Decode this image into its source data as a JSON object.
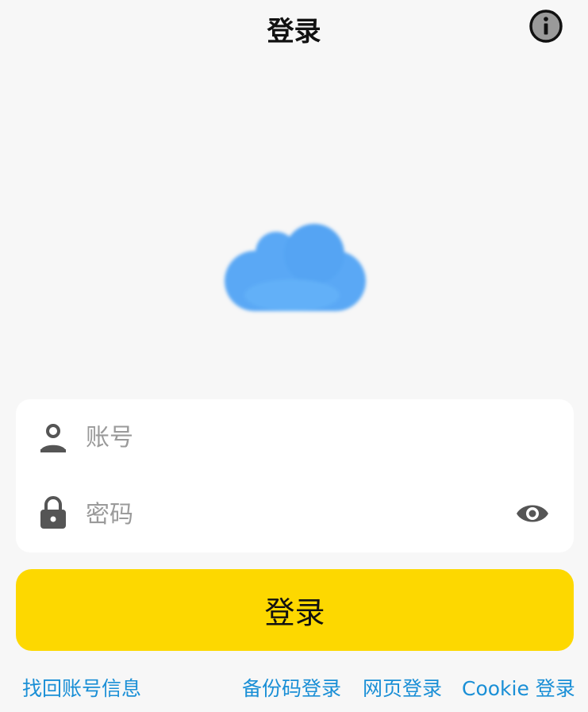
{
  "header": {
    "title": "登录",
    "info_icon": "info-circle-icon"
  },
  "logo": {
    "icon": "cloud-icon",
    "color": "#5aa8f5"
  },
  "form": {
    "account": {
      "icon": "user-icon",
      "placeholder": "账号",
      "value": ""
    },
    "password": {
      "icon": "lock-icon",
      "placeholder": "密码",
      "value": "",
      "toggle_icon": "eye-icon"
    }
  },
  "login_button": {
    "label": "登录",
    "color": "#fdd800"
  },
  "links": {
    "recover": "找回账号信息",
    "backup_code": "备份码登录",
    "web": "网页登录",
    "cookie": "Cookie 登录",
    "color": "#1a8fd6"
  }
}
